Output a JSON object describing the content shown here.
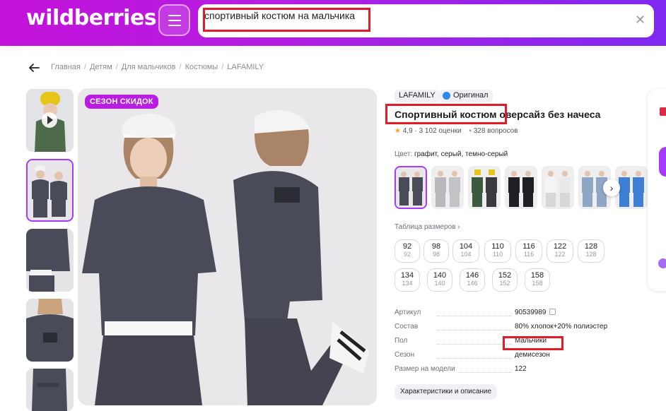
{
  "header": {
    "logo": "wildberries",
    "search_value": "спортивный костюм на мальчика",
    "clear": "✕"
  },
  "breadcrumbs": [
    "Главная",
    "Детям",
    "Для мальчиков",
    "Костюмы",
    "LAFAMILY"
  ],
  "gallery": {
    "badge": "СЕЗОН СКИДОК",
    "thumbnails": 5
  },
  "product": {
    "brand": "LAFAMILY",
    "original": "Оригинал",
    "title": "Спортивный костюм оверсайз без начеса",
    "rating": "4,9",
    "reviews": "3 102 оценки",
    "questions": "328 вопросов",
    "color_label": "Цвет:",
    "color_value": "графит, серый, темно-серый",
    "size_table": "Таблица размеров",
    "sizes": [
      {
        "size": "92",
        "sub": "92"
      },
      {
        "size": "98",
        "sub": "98"
      },
      {
        "size": "104",
        "sub": "104"
      },
      {
        "size": "110",
        "sub": "110"
      },
      {
        "size": "116",
        "sub": "116"
      },
      {
        "size": "122",
        "sub": "122"
      },
      {
        "size": "128",
        "sub": "128"
      },
      {
        "size": "134",
        "sub": "134"
      },
      {
        "size": "140",
        "sub": "140"
      },
      {
        "size": "146",
        "sub": "146"
      },
      {
        "size": "152",
        "sub": "152"
      },
      {
        "size": "158",
        "sub": "158"
      }
    ],
    "specs": [
      {
        "key": "Артикул",
        "value": "90539989"
      },
      {
        "key": "Состав",
        "value": "80% хлопок+20% полиэстер"
      },
      {
        "key": "Пол",
        "value": "Мальчики"
      },
      {
        "key": "Сезон",
        "value": "демисезон"
      },
      {
        "key": "Размер на модели",
        "value": "122"
      }
    ],
    "details_button": "Характеристики и описание"
  },
  "colors": {
    "accent": "#a73afd",
    "brand_gradient_start": "#c312d9",
    "brand_gradient_end": "#7e28f0",
    "highlight": "#e21b2a",
    "suit": "#4a4b58"
  }
}
